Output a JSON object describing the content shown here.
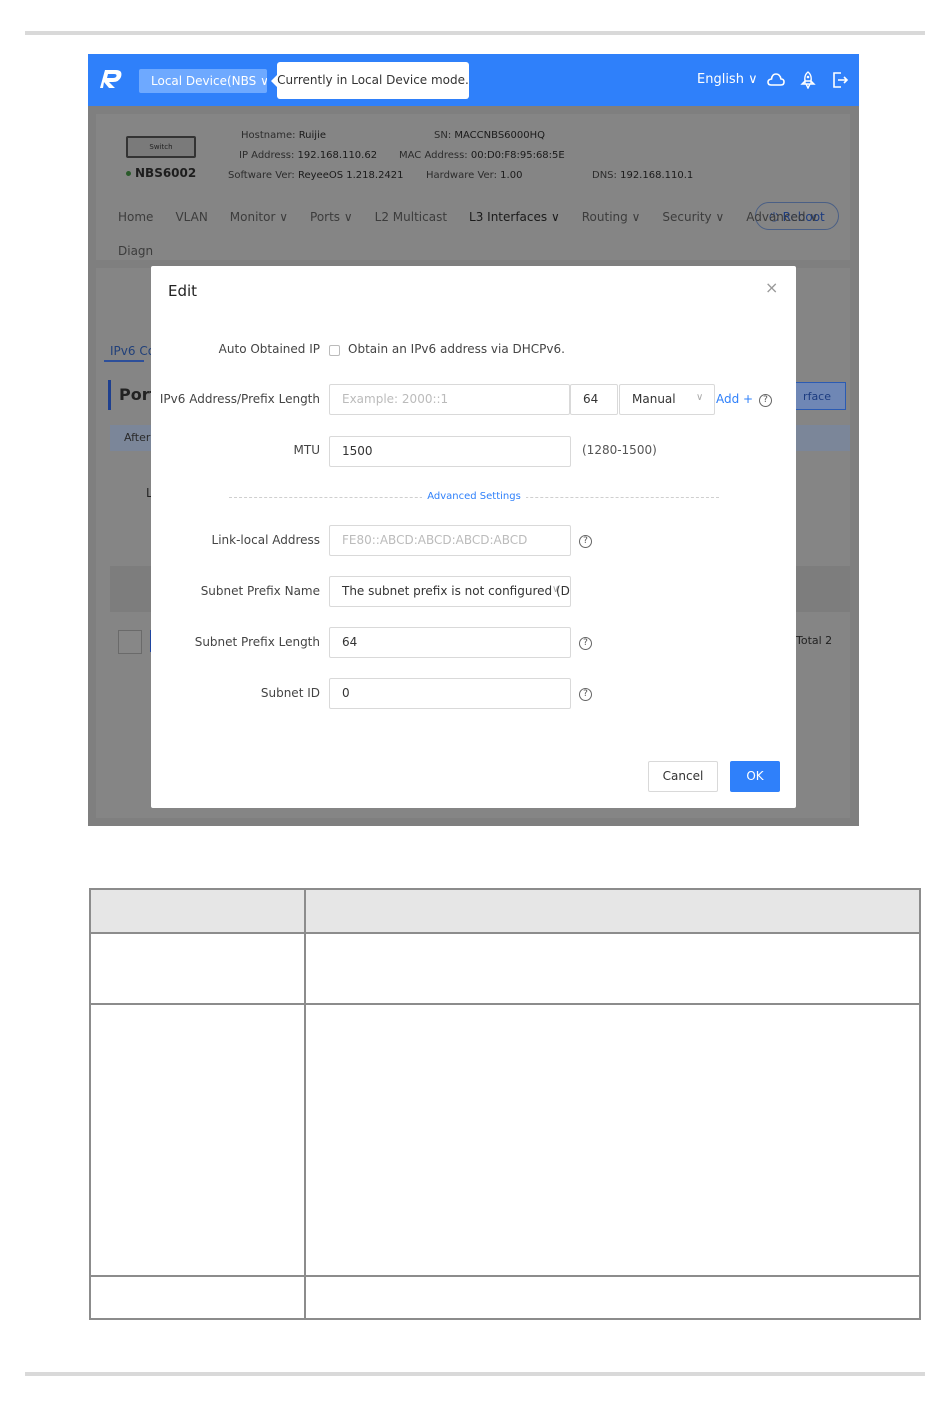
{
  "topbar": {
    "device_label": "Local Device(NBS ∨",
    "mode_tooltip": "Currently in Local Device mode.",
    "language": "English ∨"
  },
  "device": {
    "switch_label": "Switch",
    "model": "NBS6002",
    "hostname_label": "Hostname:",
    "hostname": "Ruijie",
    "ip_label": "IP Address:",
    "ip": "192.168.110.62",
    "software_label": "Software Ver:",
    "software": "ReyeeOS 1.218.2421",
    "sn_label": "SN:",
    "sn": "MACCNBS6000HQ",
    "mac_label": "MAC Address:",
    "mac": "00:D0:F8:95:68:5E",
    "hardware_label": "Hardware Ver:",
    "hardware": "1.00",
    "dns_label": "DNS:",
    "dns": "192.168.110.1",
    "reboot_label": "Reboot"
  },
  "nav": {
    "items": [
      "Home",
      "VLAN",
      "Monitor ∨",
      "Ports ∨",
      "L2 Multicast",
      "L3 Interfaces ∨",
      "Routing ∨",
      "Security ∨",
      "Advanced ∨"
    ],
    "second_row": "Diagn"
  },
  "background": {
    "tab": "IPv6 Co",
    "port_heading": "Port",
    "alert": "After",
    "interface_btn": "rface",
    "col_l": "L",
    "total": "Total 2"
  },
  "modal": {
    "title": "Edit",
    "close": "×",
    "auto_ip_label": "Auto Obtained IP",
    "auto_ip_text": "Obtain an IPv6 address via DHCPv6.",
    "ipv6_label": "IPv6 Address/Prefix Length",
    "ipv6_placeholder": "Example: 2000::1",
    "prefix_length": "64",
    "mode_select": "Manual",
    "add_link": "Add +",
    "mtu_label": "MTU",
    "mtu_value": "1500",
    "mtu_hint": "(1280-1500)",
    "advanced_settings": "Advanced Settings",
    "link_local_label": "Link-local Address",
    "link_local_placeholder": "FE80::ABCD:ABCD:ABCD:ABCD",
    "subnet_prefix_name_label": "Subnet Prefix Name",
    "subnet_prefix_name_value": "The subnet prefix is not configured  (D",
    "subnet_prefix_length_label": "Subnet Prefix Length",
    "subnet_prefix_length_value": "64",
    "subnet_id_label": "Subnet ID",
    "subnet_id_value": "0",
    "cancel_label": "Cancel",
    "ok_label": "OK"
  },
  "colors": {
    "accent": "#2f80fa",
    "topbar": "#2f80fa",
    "overlay": "#7f7f7f",
    "table_header": "#e6e6e6"
  }
}
